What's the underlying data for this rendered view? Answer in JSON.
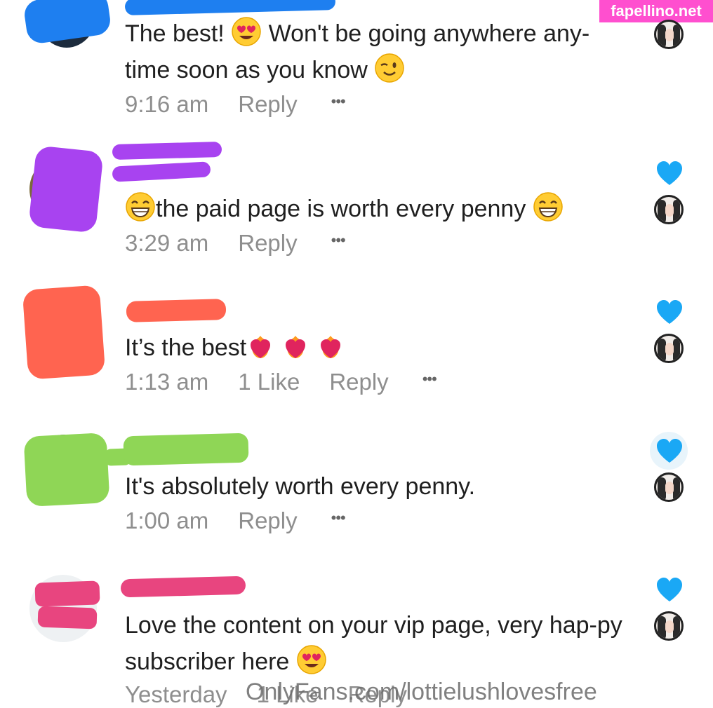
{
  "watermark": "fapellino.net",
  "colors": {
    "heart": "#1aa8f5",
    "meta_text": "#8e8e8e",
    "scribble_blue": "#1e7ff0",
    "scribble_purple": "#a843f0",
    "scribble_red": "#ff6450",
    "scribble_green": "#8fd656",
    "scribble_pink": "#e8457f"
  },
  "comments": [
    {
      "text_before": "The best! ",
      "emoji_1": "heart-eyes-emoji",
      "text_mid": " Won't be going anywhere any-time soon as you know ",
      "emoji_2": "wink-emoji",
      "time": "9:16 am",
      "reply": "Reply",
      "more": "•••",
      "liked": false
    },
    {
      "text": "the paid page is worth every penny",
      "emoji": "grin-emoji",
      "time": "3:29 am",
      "reply": "Reply",
      "more": "•••",
      "liked": true
    },
    {
      "text": "It’s the best",
      "emoji": "heart-on-fire-emoji",
      "time": "1:13 am",
      "likes": "1 Like",
      "reply": "Reply",
      "more": "•••",
      "liked": true
    },
    {
      "text": "It's absolutely worth every penny.",
      "time": "1:00 am",
      "reply": "Reply",
      "more": "•••",
      "liked": true
    },
    {
      "text": "Love the content on your vip page, very hap-py subscriber here ",
      "emoji": "heart-eyes-emoji",
      "time": "Yesterday",
      "likes": "1 Like",
      "reply": "Reply",
      "liked": true
    }
  ],
  "overlay_text": "OnlyFans.com/lottielushlovesfree"
}
